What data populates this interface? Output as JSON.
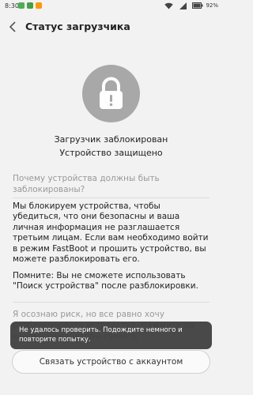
{
  "status_bar": {
    "time": "8:30",
    "battery_percent": "92%",
    "icons": [
      "notification-green-icon",
      "notification-green-icon",
      "notification-orange-icon",
      "wifi-icon",
      "signal-icon",
      "battery-icon"
    ]
  },
  "appbar": {
    "back_icon": "chevron-left-icon",
    "title": "Статус загрузчика"
  },
  "lock": {
    "icon": "lock-icon",
    "colors": {
      "circle": "#a8a8a8",
      "glyph": "#ffffff",
      "mark": "#a8a8a8"
    }
  },
  "status": {
    "line1": "Загрузчик заблокирован",
    "line2": "Устройство защищено"
  },
  "question": "Почему устройства должны быть заблокированы?",
  "explanation": "Мы блокируем устройства, чтобы убедиться, что они безопасны и ваша личная информация не разглашается третьим лицам. Если вам необходимо войти в режим FastBoot и прошить устройство, вы можете разблокировать его.",
  "note": "Помните: Вы не сможете использовать \"Поиск устройства\" после разблокировки.",
  "risk_text": "Я осознаю риск, но все равно хочу разблокировать устройство. Нажмите на кнопку ниже, чтобы связать",
  "bind_button": "Связать устройство с аккаунтом",
  "toast": "Не удалось проверить. Подождите немного и повторите попытку."
}
